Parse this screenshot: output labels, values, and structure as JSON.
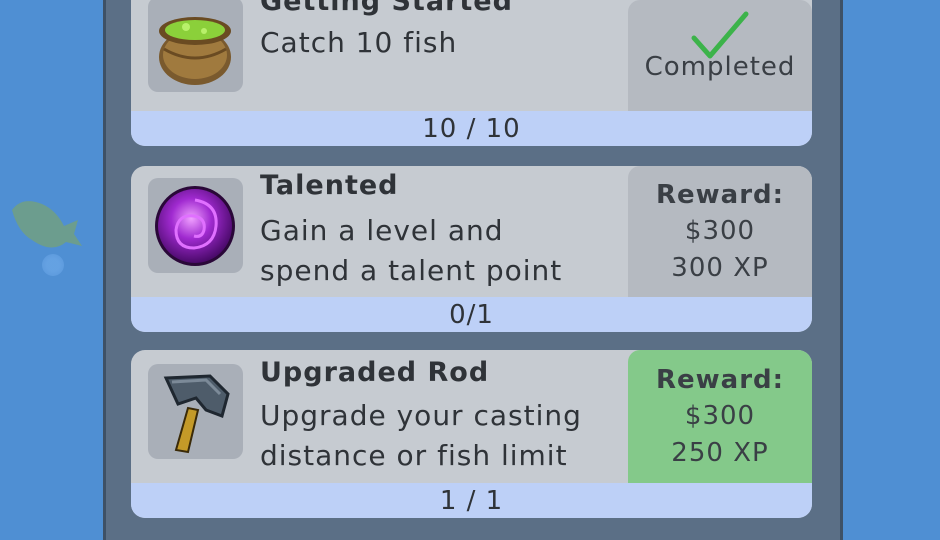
{
  "quests": [
    {
      "title": "Getting Started",
      "description": [
        "Catch 10 fish"
      ],
      "status": "Completed",
      "progress": "10 / 10",
      "icon": "cauldron-icon"
    },
    {
      "title": "Talented",
      "description": [
        "Gain a level and",
        "spend a talent point"
      ],
      "reward_label": "Reward:",
      "reward_money": "$300",
      "reward_xp": "300 XP",
      "progress": "0/1",
      "icon": "purple-orb-icon"
    },
    {
      "title": "Upgraded Rod",
      "description": [
        "Upgrade your casting",
        "distance or fish limit"
      ],
      "reward_label": "Reward:",
      "reward_money": "$300",
      "reward_xp": "250 XP",
      "progress": "1 / 1",
      "icon": "hammer-icon",
      "claimable": true
    }
  ],
  "colors": {
    "water": "#4f8fd3",
    "card": "#c6cbd1",
    "progress_bar": "#bdd0f7",
    "claimable": "#84c98a",
    "check": "#3cb34a"
  }
}
